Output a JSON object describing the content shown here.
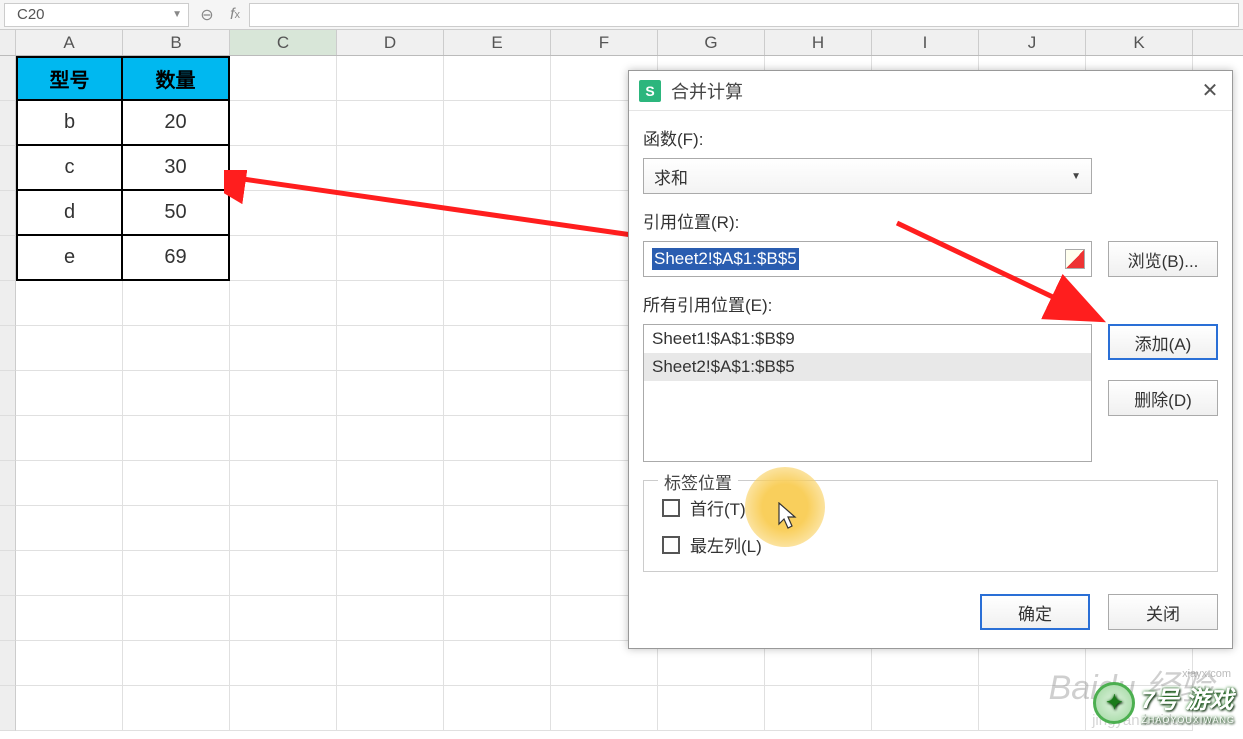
{
  "name_box": {
    "value": "C20"
  },
  "columns": [
    "A",
    "B",
    "C",
    "D",
    "E",
    "F",
    "G",
    "H",
    "I",
    "J",
    "K"
  ],
  "table": {
    "headers": [
      "型号",
      "数量"
    ],
    "rows": [
      {
        "model": "b",
        "qty": "20"
      },
      {
        "model": "c",
        "qty": "30"
      },
      {
        "model": "d",
        "qty": "50"
      },
      {
        "model": "e",
        "qty": "69"
      }
    ]
  },
  "dialog": {
    "title": "合并计算",
    "function_label": "函数(F):",
    "function_value": "求和",
    "ref_label": "引用位置(R):",
    "ref_value": "Sheet2!$A$1:$B$5",
    "browse_btn": "浏览(B)...",
    "all_ref_label": "所有引用位置(E):",
    "ref_list": [
      "Sheet1!$A$1:$B$9",
      "Sheet2!$A$1:$B$5"
    ],
    "add_btn": "添加(A)",
    "delete_btn": "删除(D)",
    "label_pos_legend": "标签位置",
    "top_row_chk": "首行(T)",
    "left_col_chk": "最左列(L)",
    "ok_btn": "确定",
    "close_btn": "关闭"
  },
  "watermark": {
    "brand": "Baidu 经验",
    "url": "jingyan.baidu.com",
    "site2": "7号 游戏",
    "site2_sub": "ZHAOYOUXIWANG",
    "sitehost": "xiayx.com"
  }
}
